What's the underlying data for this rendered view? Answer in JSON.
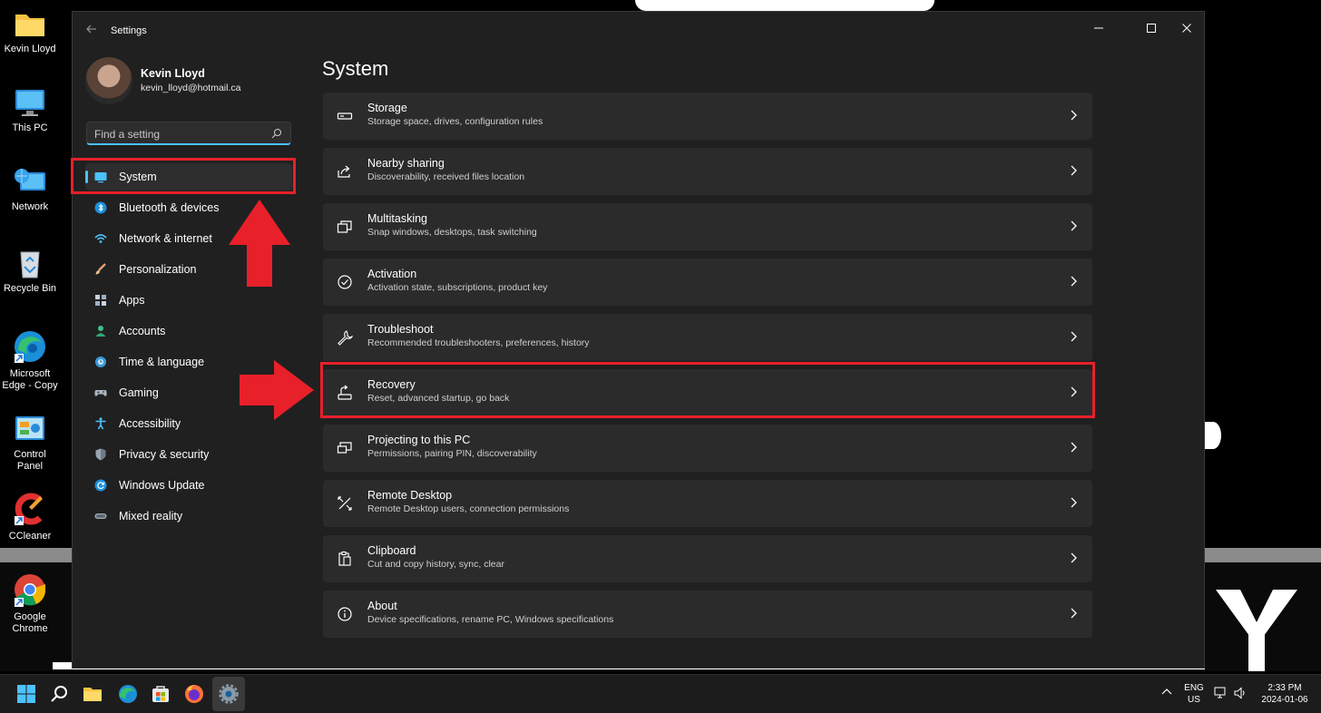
{
  "desktop": {
    "icons": [
      {
        "label": "Kevin Lloyd",
        "icon": "folder-icon"
      },
      {
        "label": "This PC",
        "icon": "monitor-icon"
      },
      {
        "label": "Network",
        "icon": "network-icon"
      },
      {
        "label": "Recycle Bin",
        "icon": "recycle-bin-icon"
      },
      {
        "label": "Microsoft Edge - Copy",
        "icon": "edge-icon"
      },
      {
        "label": "Control Panel",
        "icon": "control-panel-icon"
      },
      {
        "label": "CCleaner",
        "icon": "ccleaner-icon"
      },
      {
        "label": "Google Chrome",
        "icon": "chrome-icon"
      }
    ]
  },
  "window": {
    "title": "Settings",
    "back_icon": "back-arrow-icon",
    "controls": [
      "minimize-icon",
      "maximize-icon",
      "close-icon"
    ]
  },
  "user": {
    "name": "Kevin Lloyd",
    "email": "kevin_lloyd@hotmail.ca"
  },
  "search": {
    "placeholder": "Find a setting",
    "value": ""
  },
  "sidebar": {
    "items": [
      {
        "label": "System",
        "icon": "system-icon",
        "active": true
      },
      {
        "label": "Bluetooth & devices",
        "icon": "bluetooth-icon"
      },
      {
        "label": "Network & internet",
        "icon": "wifi-icon"
      },
      {
        "label": "Personalization",
        "icon": "brush-icon"
      },
      {
        "label": "Apps",
        "icon": "apps-icon"
      },
      {
        "label": "Accounts",
        "icon": "accounts-icon"
      },
      {
        "label": "Time & language",
        "icon": "globe-clock-icon"
      },
      {
        "label": "Gaming",
        "icon": "controller-icon"
      },
      {
        "label": "Accessibility",
        "icon": "accessibility-icon"
      },
      {
        "label": "Privacy & security",
        "icon": "shield-icon"
      },
      {
        "label": "Windows Update",
        "icon": "update-icon"
      },
      {
        "label": "Mixed reality",
        "icon": "headset-icon"
      }
    ]
  },
  "main": {
    "title": "System",
    "cards": [
      {
        "title": "Storage",
        "subtitle": "Storage space, drives, configuration rules",
        "icon": "storage-icon"
      },
      {
        "title": "Nearby sharing",
        "subtitle": "Discoverability, received files location",
        "icon": "share-icon"
      },
      {
        "title": "Multitasking",
        "subtitle": "Snap windows, desktops, task switching",
        "icon": "multitasking-icon"
      },
      {
        "title": "Activation",
        "subtitle": "Activation state, subscriptions, product key",
        "icon": "activation-check-icon"
      },
      {
        "title": "Troubleshoot",
        "subtitle": "Recommended troubleshooters, preferences, history",
        "icon": "wrench-icon"
      },
      {
        "title": "Recovery",
        "subtitle": "Reset, advanced startup, go back",
        "icon": "recovery-icon"
      },
      {
        "title": "Projecting to this PC",
        "subtitle": "Permissions, pairing PIN, discoverability",
        "icon": "projecting-icon"
      },
      {
        "title": "Remote Desktop",
        "subtitle": "Remote Desktop users, connection permissions",
        "icon": "remote-desktop-icon"
      },
      {
        "title": "Clipboard",
        "subtitle": "Cut and copy history, sync, clear",
        "icon": "clipboard-icon"
      },
      {
        "title": "About",
        "subtitle": "Device specifications, rename PC, Windows specifications",
        "icon": "info-icon"
      }
    ]
  },
  "annotations": {
    "color": "#e8202a"
  },
  "taskbar": {
    "apps": [
      "start-icon",
      "search-icon",
      "file-explorer-icon",
      "edge-icon",
      "store-icon",
      "firefox-icon",
      "settings-gear-icon"
    ],
    "lang_top": "ENG",
    "lang_bottom": "US",
    "time": "2:33 PM",
    "date": "2024-01-06"
  },
  "colors": {
    "accent": "#4cc2ff",
    "window_bg": "#202020",
    "card_bg": "#2b2b2b"
  }
}
